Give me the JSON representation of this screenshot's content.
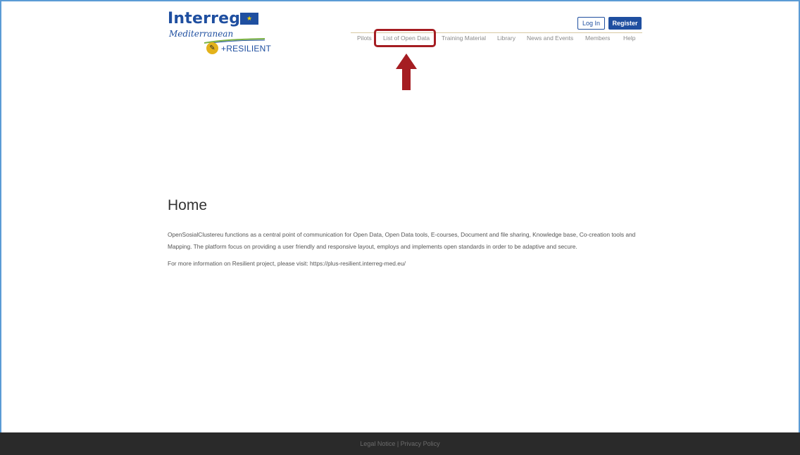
{
  "logo": {
    "name": "Interreg",
    "region": "Mediterranean",
    "project": "+RESILIENT"
  },
  "auth": {
    "login_label": "Log In",
    "register_label": "Register"
  },
  "nav": {
    "items": [
      {
        "label": "Pilots"
      },
      {
        "label": "List of Open Data"
      },
      {
        "label": "Training Material"
      },
      {
        "label": "Library"
      },
      {
        "label": "News and Events"
      },
      {
        "label": "Members"
      },
      {
        "label": "Help"
      }
    ]
  },
  "annotation": {
    "highlight_color": "#a51d22"
  },
  "main": {
    "title": "Home",
    "paragraph1": "OpenSosialClustereu functions as a central point of communication for Open Data, Open Data tools, E-courses, Document and file sharing, Knowledge base, Co-creation tools and Mapping. The platform focus on providing a user friendly and responsive layout, employs and implements open standards in order to be adaptive and secure.",
    "paragraph2": "For more information on Resilient project, please visit: https://plus-resilient.interreg-med.eu/"
  },
  "footer": {
    "text": "Legal Notice | Privacy Policy"
  },
  "colors": {
    "brand_blue": "#1f4fa0",
    "footer_bg": "#2a2a2a"
  }
}
